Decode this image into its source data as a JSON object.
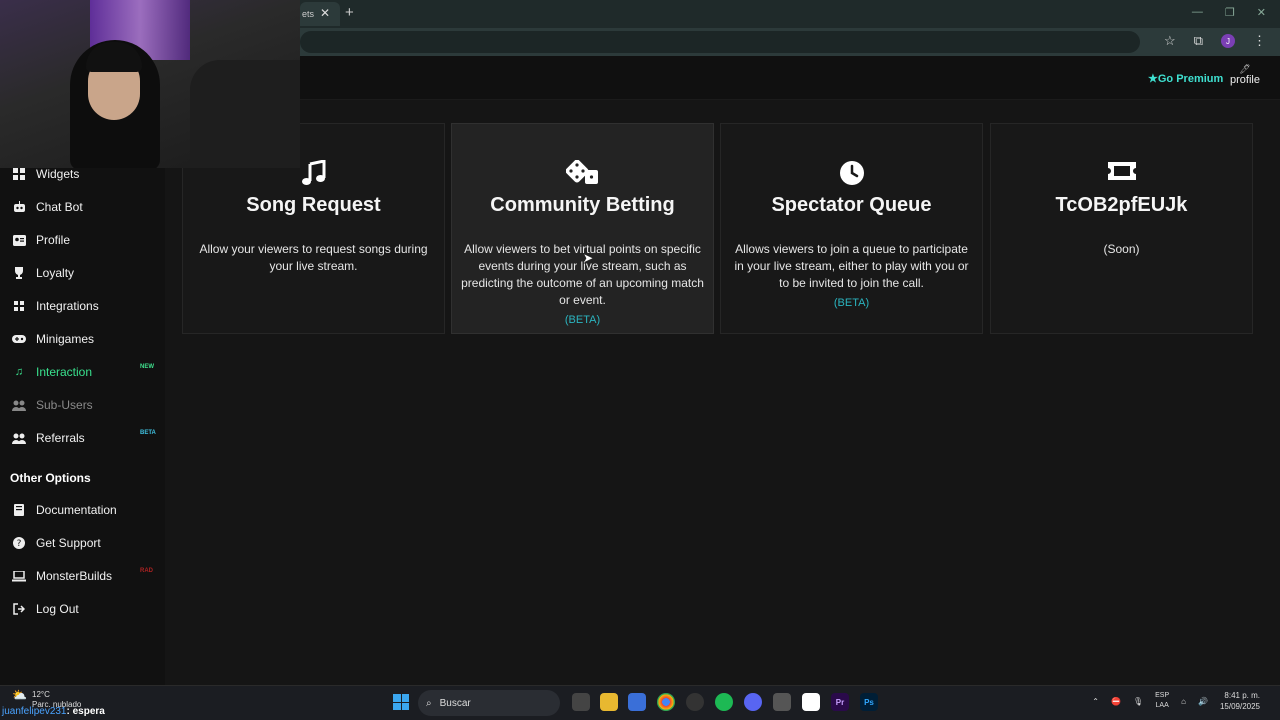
{
  "browser": {
    "tab_label": "ets",
    "tab_close": "✕",
    "new_tab": "+",
    "avatar_letter": "J"
  },
  "header": {
    "go_premium": "Go Premium",
    "profile_label": "profile"
  },
  "sidebar": {
    "items": [
      {
        "label": "Widgets"
      },
      {
        "label": "Chat Bot"
      },
      {
        "label": "Profile"
      },
      {
        "label": "Loyalty"
      },
      {
        "label": "Integrations"
      },
      {
        "label": "Minigames"
      },
      {
        "label": "Interaction",
        "badge": "NEW"
      },
      {
        "label": "Sub-Users"
      },
      {
        "label": "Referrals",
        "badge": "BETA"
      }
    ],
    "other_title": "Other Options",
    "other_items": [
      {
        "label": "Documentation"
      },
      {
        "label": "Get Support"
      },
      {
        "label": "MonsterBuilds",
        "badge": "RAD"
      },
      {
        "label": "Log Out"
      }
    ]
  },
  "cards": [
    {
      "title": "Song Request",
      "description": "Allow your viewers to request songs during your live stream.",
      "icon": "music-icon"
    },
    {
      "title": "Community Betting",
      "description": "Allow viewers to bet virtual points on specific events during your live stream, such as predicting the outcome of an upcoming match or event.",
      "beta": "(BETA)",
      "icon": "dice-icon"
    },
    {
      "title": "Spectator Queue",
      "description": "Allows viewers to join a queue to participate in your live stream, either to play with you or to be invited to join the call.",
      "beta": "(BETA)",
      "icon": "clock-icon"
    },
    {
      "title": "TcOB2pfEUJk",
      "description": "(Soon)",
      "icon": "ticket-icon"
    }
  ],
  "taskbar": {
    "weather_temp": "12°C",
    "weather_desc": "Parc. nublado",
    "chat_user": "juanfelipev231",
    "chat_message": ": espera",
    "search_label": "Buscar",
    "lang_top": "ESP",
    "lang_bottom": "LAA",
    "time": "8:41 p. m.",
    "date": "15/09/2025"
  },
  "colors": {
    "accent_teal": "#3fe0d0",
    "active_green": "#39e08d",
    "beta_blue": "#2bb5c0"
  }
}
